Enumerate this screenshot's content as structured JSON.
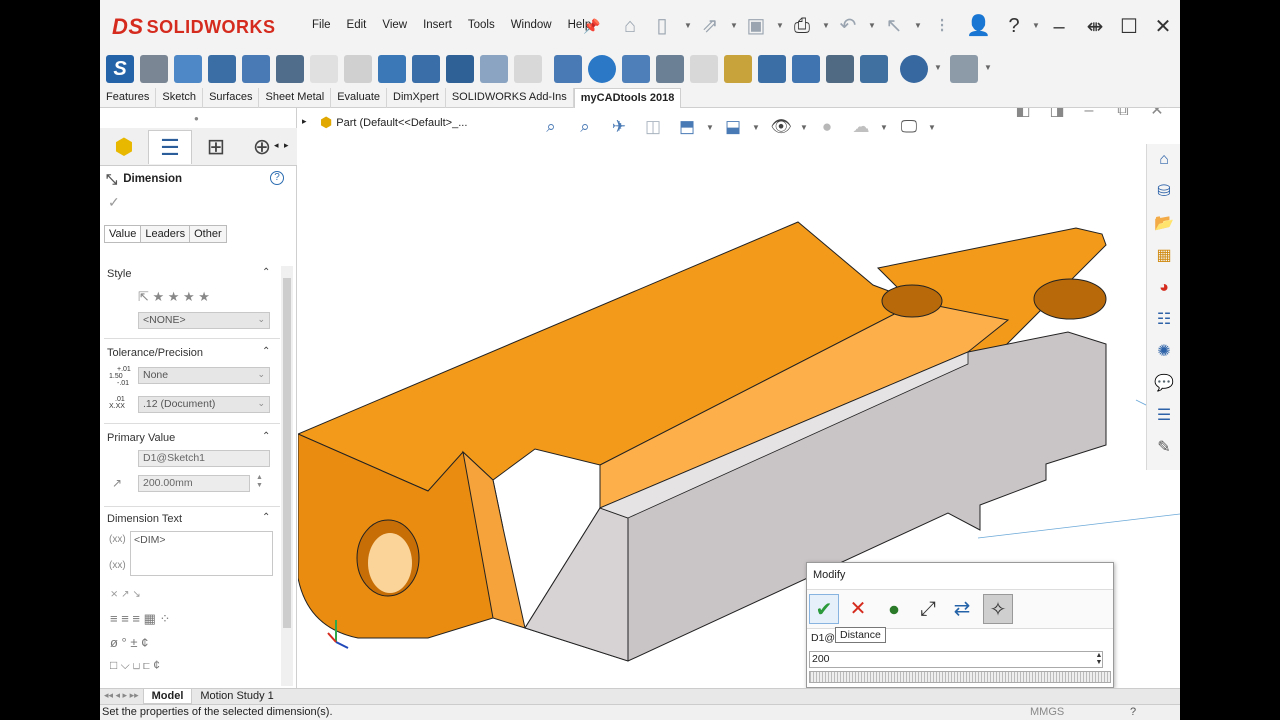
{
  "app": {
    "brand": "SOLIDWORKS",
    "menus": [
      "File",
      "Edit",
      "View",
      "Insert",
      "Tools",
      "Window",
      "Help"
    ]
  },
  "command_tabs": [
    "Features",
    "Sketch",
    "Surfaces",
    "Sheet Metal",
    "Evaluate",
    "DimXpert",
    "SOLIDWORKS Add-Ins",
    "myCADtools 2018"
  ],
  "active_command_tab": "myCADtools 2018",
  "property_manager": {
    "title": "Dimension",
    "subtabs": [
      "Value",
      "Leaders",
      "Other"
    ],
    "style": {
      "header": "Style",
      "combo": "<NONE>"
    },
    "tolerance": {
      "header": "Tolerance/Precision",
      "type": "None",
      "precision": ".12 (Document)",
      "icon_top": "1.50",
      "icon_top_sup": "+.01",
      "icon_top_sub": "-.01",
      "icon_bottom": "X.XX",
      "icon_bottom_sup": ".01"
    },
    "primary_value": {
      "header": "Primary Value",
      "name": "D1@Sketch1",
      "value": "200.00mm"
    },
    "dimension_text": {
      "header": "Dimension Text",
      "text": "<DIM>",
      "prefix1": "(xx)",
      "prefix2": "(xx)"
    }
  },
  "viewport": {
    "breadcrumb": "Part  (Default<<Default>_..."
  },
  "modify": {
    "title": "Modify",
    "name_prefix": "D1@",
    "value": "200",
    "tooltip": "Distance"
  },
  "bottom_tabs": [
    "Model",
    "Motion Study 1"
  ],
  "status": {
    "text": "Set the properties of the selected dimension(s).",
    "units": "MMGS"
  },
  "colors": {
    "accent": "#d52b1e",
    "part_orange": "#f39a1b",
    "part_gray": "#c9c4c6"
  }
}
